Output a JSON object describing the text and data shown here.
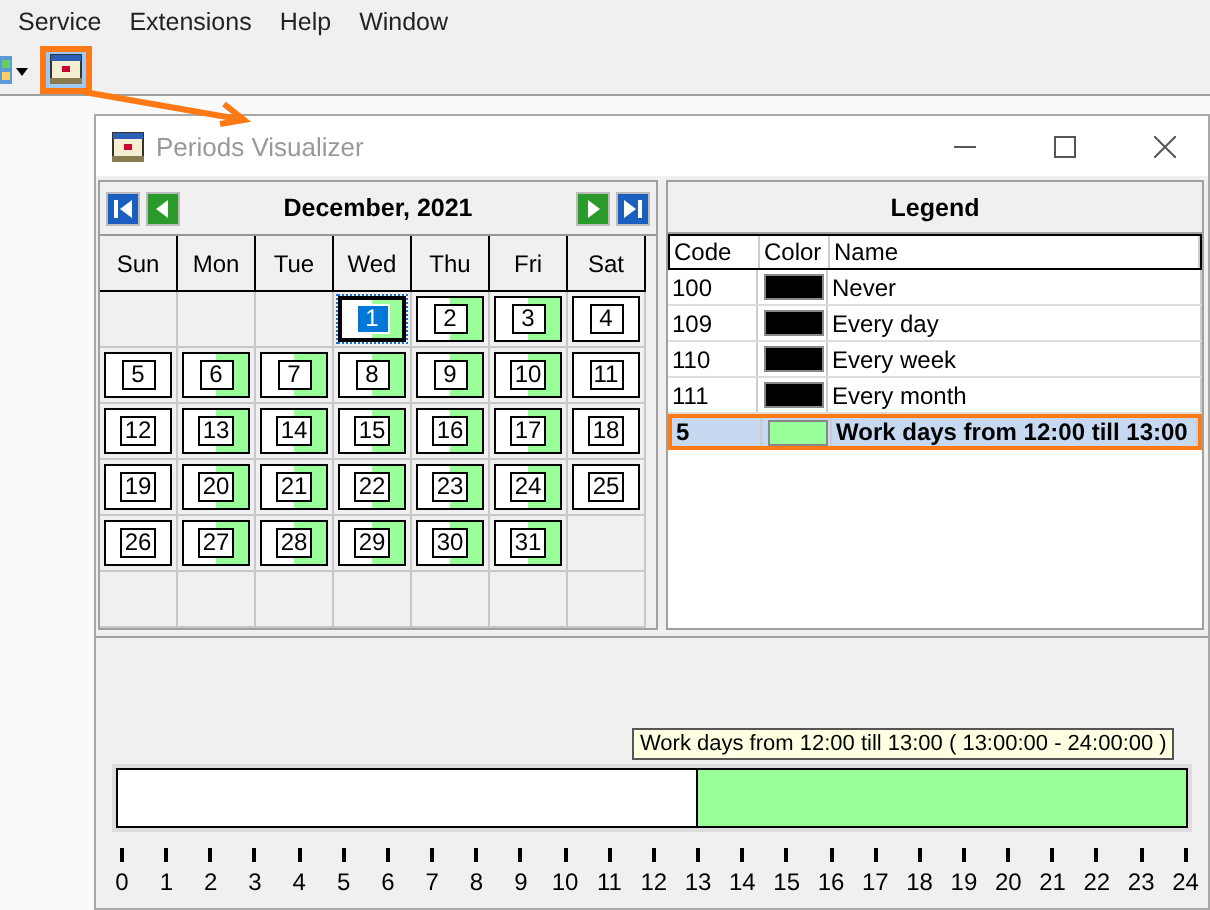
{
  "menu": [
    {
      "label": "Service"
    },
    {
      "label": "Extensions"
    },
    {
      "label": "Help"
    },
    {
      "label": "Window"
    }
  ],
  "toolbar": {
    "highlighted": true
  },
  "window": {
    "title": "Periods Visualizer",
    "active": false
  },
  "calendar": {
    "month": "December, 2021",
    "weekdays": [
      "Sun",
      "Mon",
      "Tue",
      "Wed",
      "Thu",
      "Fri",
      "Sat"
    ],
    "cells": [
      {
        "kind": "empty"
      },
      {
        "kind": "empty"
      },
      {
        "kind": "empty"
      },
      {
        "kind": "day",
        "day": "1",
        "marked": true,
        "selected": true
      },
      {
        "kind": "day",
        "day": "2",
        "marked": true,
        "selected": false
      },
      {
        "kind": "day",
        "day": "3",
        "marked": true,
        "selected": false
      },
      {
        "kind": "day",
        "day": "4",
        "marked": false,
        "selected": false
      },
      {
        "kind": "day",
        "day": "5",
        "marked": false,
        "selected": false
      },
      {
        "kind": "day",
        "day": "6",
        "marked": true,
        "selected": false
      },
      {
        "kind": "day",
        "day": "7",
        "marked": true,
        "selected": false
      },
      {
        "kind": "day",
        "day": "8",
        "marked": true,
        "selected": false
      },
      {
        "kind": "day",
        "day": "9",
        "marked": true,
        "selected": false
      },
      {
        "kind": "day",
        "day": "10",
        "marked": true,
        "selected": false
      },
      {
        "kind": "day",
        "day": "11",
        "marked": false,
        "selected": false
      },
      {
        "kind": "day",
        "day": "12",
        "marked": false,
        "selected": false
      },
      {
        "kind": "day",
        "day": "13",
        "marked": true,
        "selected": false
      },
      {
        "kind": "day",
        "day": "14",
        "marked": true,
        "selected": false
      },
      {
        "kind": "day",
        "day": "15",
        "marked": true,
        "selected": false
      },
      {
        "kind": "day",
        "day": "16",
        "marked": true,
        "selected": false
      },
      {
        "kind": "day",
        "day": "17",
        "marked": true,
        "selected": false
      },
      {
        "kind": "day",
        "day": "18",
        "marked": false,
        "selected": false
      },
      {
        "kind": "day",
        "day": "19",
        "marked": false,
        "selected": false
      },
      {
        "kind": "day",
        "day": "20",
        "marked": true,
        "selected": false
      },
      {
        "kind": "day",
        "day": "21",
        "marked": true,
        "selected": false
      },
      {
        "kind": "day",
        "day": "22",
        "marked": true,
        "selected": false
      },
      {
        "kind": "day",
        "day": "23",
        "marked": true,
        "selected": false
      },
      {
        "kind": "day",
        "day": "24",
        "marked": true,
        "selected": false
      },
      {
        "kind": "day",
        "day": "25",
        "marked": false,
        "selected": false
      },
      {
        "kind": "day",
        "day": "26",
        "marked": false,
        "selected": false
      },
      {
        "kind": "day",
        "day": "27",
        "marked": true,
        "selected": false
      },
      {
        "kind": "day",
        "day": "28",
        "marked": true,
        "selected": false
      },
      {
        "kind": "day",
        "day": "29",
        "marked": true,
        "selected": false
      },
      {
        "kind": "day",
        "day": "30",
        "marked": true,
        "selected": false
      },
      {
        "kind": "day",
        "day": "31",
        "marked": true,
        "selected": false
      },
      {
        "kind": "empty"
      },
      {
        "kind": "empty"
      },
      {
        "kind": "empty"
      },
      {
        "kind": "empty"
      },
      {
        "kind": "empty"
      },
      {
        "kind": "empty"
      },
      {
        "kind": "empty"
      },
      {
        "kind": "empty"
      }
    ]
  },
  "legend": {
    "title": "Legend",
    "columns": [
      "Code",
      "Color",
      "Name"
    ],
    "rows": [
      {
        "code": "100",
        "color": "#000000",
        "name": "Never",
        "selected": false
      },
      {
        "code": "109",
        "color": "#000000",
        "name": "Every day",
        "selected": false
      },
      {
        "code": "110",
        "color": "#000000",
        "name": "Every week",
        "selected": false
      },
      {
        "code": "111",
        "color": "#000000",
        "name": "Every month",
        "selected": false
      },
      {
        "code": "5",
        "color": "#99ff99",
        "name": "Work days from 12:00 till 13:00",
        "selected": true
      }
    ]
  },
  "timeline": {
    "tooltip": "Work days from 12:00 till 13:00 ( 13:00:00 - 24:00:00 )",
    "level": 0.4583,
    "hours": [
      "0",
      "1",
      "2",
      "3",
      "4",
      "5",
      "6",
      "7",
      "8",
      "9",
      "10",
      "11",
      "12",
      "13",
      "14",
      "15",
      "16",
      "17",
      "18",
      "19",
      "20",
      "21",
      "22",
      "23",
      "24"
    ]
  }
}
